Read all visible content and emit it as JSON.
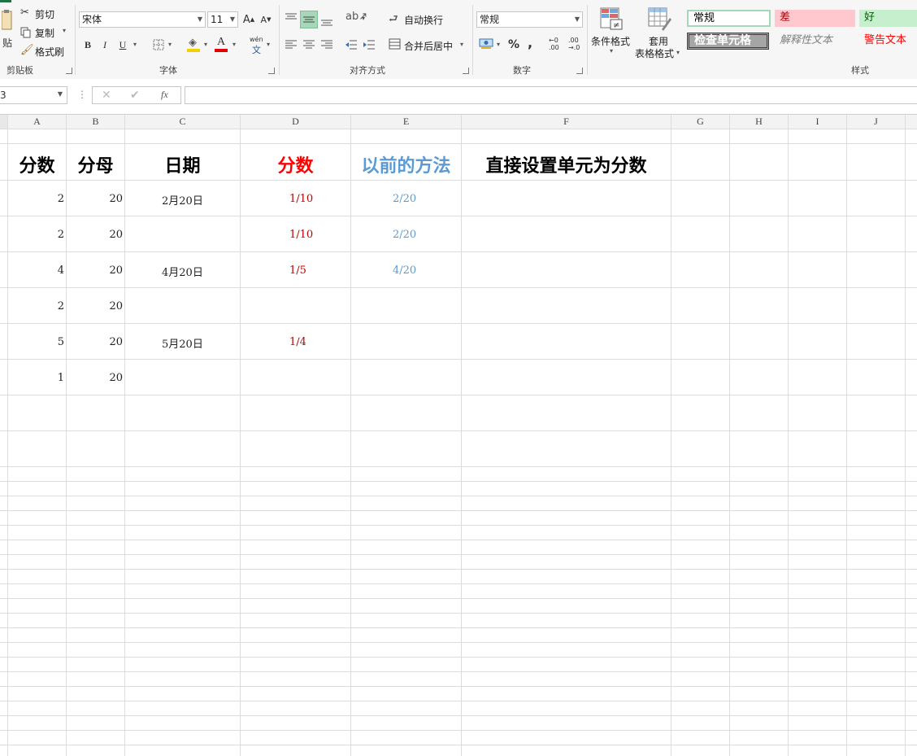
{
  "clipboard": {
    "paste_label": "贴",
    "cut_label": "剪切",
    "copy_label": "复制",
    "format_painter_label": "格式刷",
    "group_label": "剪贴板"
  },
  "font": {
    "font_name": "宋体",
    "font_size": "11",
    "bold": "B",
    "italic": "I",
    "underline": "U",
    "phonetic": "wén",
    "phonetic_sub": "文",
    "group_label": "字体",
    "fill_color": "#f5d000",
    "font_color": "#e00000"
  },
  "alignment": {
    "wrap_text_label": "自动换行",
    "merge_center_label": "合并后居中",
    "group_label": "对齐方式"
  },
  "number": {
    "format_value": "常规",
    "percent": "%",
    "comma": ",",
    "group_label": "数字"
  },
  "styles": {
    "conditional_format_label": "条件格式",
    "table_format_label_1": "套用",
    "table_format_label_2": "表格格式",
    "normal": "常规",
    "bad": "差",
    "good": "好",
    "check_cell": "检查单元格",
    "explanatory": "解释性文本",
    "warning": "警告文本",
    "group_label": "样式"
  },
  "formula_bar": {
    "name_box": "3",
    "fx": "fx",
    "formula_value": ""
  },
  "columns": [
    "A",
    "B",
    "C",
    "D",
    "E",
    "F",
    "G",
    "H",
    "I",
    "J"
  ],
  "headers": {
    "A": "分数",
    "B": "分母",
    "C": "日期",
    "D": "分数",
    "E": "以前的方法",
    "F": "直接设置单元为分数"
  },
  "rows": [
    {
      "A": "2",
      "B": "20",
      "C": "2月20日",
      "D": "1/10",
      "E": "2/20"
    },
    {
      "A": "2",
      "B": "20",
      "C": "",
      "D": "1/10",
      "E": "2/20"
    },
    {
      "A": "4",
      "B": "20",
      "C": "4月20日",
      "D": "1/5",
      "E": "4/20"
    },
    {
      "A": "2",
      "B": "20",
      "C": "",
      "D": "",
      "E": ""
    },
    {
      "A": "5",
      "B": "20",
      "C": "5月20日",
      "D": "1/4",
      "E": ""
    },
    {
      "A": "1",
      "B": "20",
      "C": "",
      "D": "",
      "E": ""
    }
  ],
  "colors": {
    "fraction_red": "#c00000",
    "fraction_blue": "#5b9bd5",
    "header_red": "#ff0000",
    "header_blue": "#5b9bd5"
  }
}
